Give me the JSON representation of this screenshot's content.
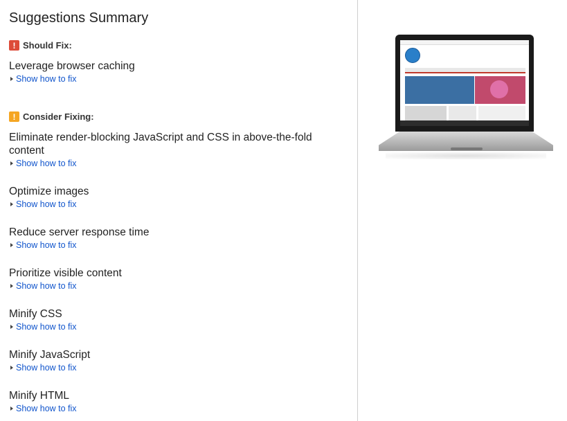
{
  "title": "Suggestions Summary",
  "should_fix": {
    "label": "Should Fix:",
    "badge": "!",
    "items": [
      {
        "title": "Leverage browser caching",
        "link": "Show how to fix"
      }
    ]
  },
  "consider_fixing": {
    "label": "Consider Fixing:",
    "badge": "!",
    "items": [
      {
        "title": "Eliminate render-blocking JavaScript and CSS in above-the-fold content",
        "link": "Show how to fix"
      },
      {
        "title": "Optimize images",
        "link": "Show how to fix"
      },
      {
        "title": "Reduce server response time",
        "link": "Show how to fix"
      },
      {
        "title": "Prioritize visible content",
        "link": "Show how to fix"
      },
      {
        "title": "Minify CSS",
        "link": "Show how to fix"
      },
      {
        "title": "Minify JavaScript",
        "link": "Show how to fix"
      },
      {
        "title": "Minify HTML",
        "link": "Show how to fix"
      }
    ]
  },
  "colors": {
    "should_fix_badge": "#dd4b39",
    "consider_badge": "#f5a623",
    "link": "#1155cc"
  }
}
